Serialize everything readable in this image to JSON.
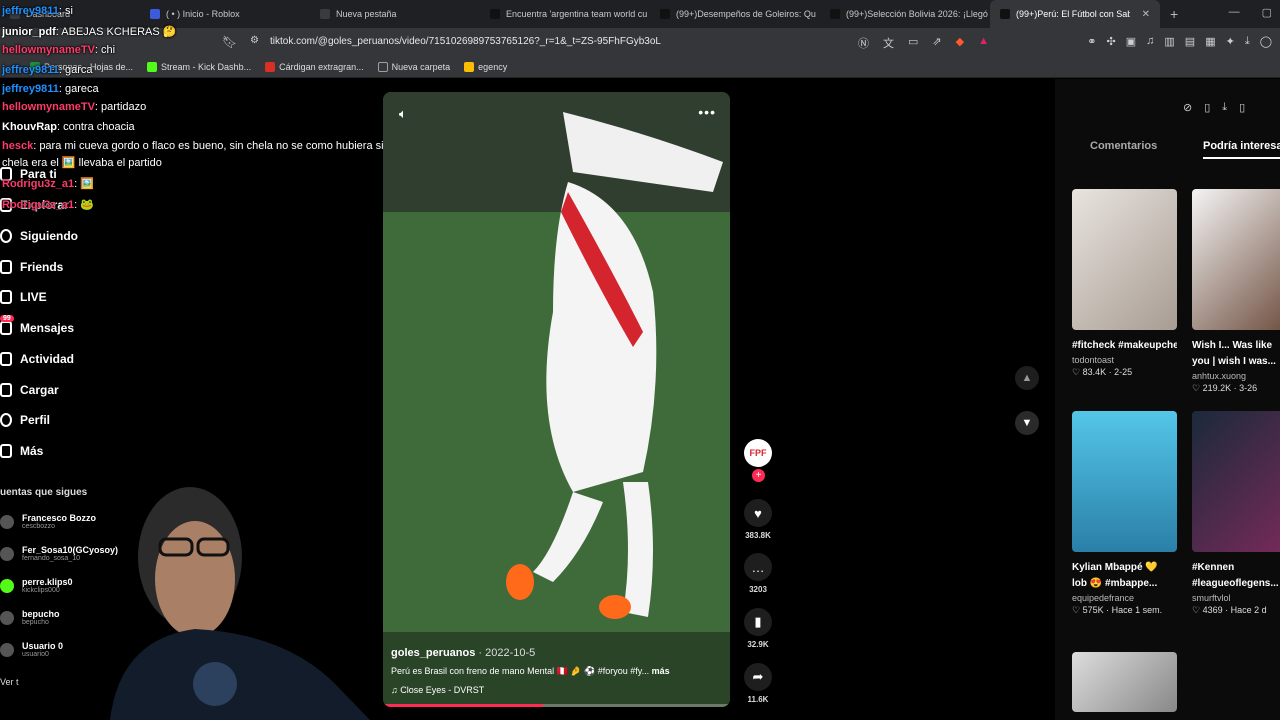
{
  "browser": {
    "tabs": [
      {
        "label": "Dashboard",
        "active": false
      },
      {
        "label": "( • ) Inicio - Roblox",
        "active": false
      },
      {
        "label": "Nueva pestaña",
        "active": false
      },
      {
        "label": "Encuentra 'argentina team world cu",
        "active": false
      },
      {
        "label": "(99+)Desempeños de Goleiros: Qu",
        "active": false
      },
      {
        "label": "(99+)Selección Bolivia 2026: ¡Llegó l",
        "active": false
      },
      {
        "label": "(99+)Perú: El Fútbol con Sabor a",
        "active": true
      }
    ],
    "new_tab_icon": "plus-icon",
    "url": "tiktok.com/@goles_peruanos/video/7151026989753765126?_r=1&_t=ZS-95FhFGyb3oL",
    "bookmarks": [
      {
        "label": "Personas · Hojas de...",
        "color": "#1e8e3e"
      },
      {
        "label": "Stream - Kick Dashb...",
        "color": "#53fc18"
      },
      {
        "label": "Cárdigan extragran...",
        "color": "#d93025"
      },
      {
        "label": "Nueva carpeta",
        "color": "#9aa0a6"
      },
      {
        "label": "egency",
        "color": "#fbbc04"
      }
    ]
  },
  "chat": [
    {
      "user": "jeffrey9811",
      "text": ": si",
      "color": "#1e90ff"
    },
    {
      "user": "junior_pdf",
      "text": ": ABEJAS KCHERAS 🤔",
      "color": "#ffffff"
    },
    {
      "user": "hellowmynameTV",
      "text": ": chi",
      "color": "#ff3b6b"
    },
    {
      "user": "jeffrey9811",
      "text": ": garca",
      "color": "#1e90ff"
    },
    {
      "user": "jeffrey9811",
      "text": ": gareca",
      "color": "#1e90ff"
    },
    {
      "user": "hellowmynameTV",
      "text": ": partidazo",
      "color": "#ff3b6b"
    },
    {
      "user": "KhouvRap",
      "text": ": contra choacia",
      "color": "#ffffff"
    },
    {
      "user": "hesck",
      "text": ": para mi cueva gordo o flaco es bueno, sin chela no se como hubiera sido, con",
      "color": "#ff3b6b"
    },
    {
      "user": "",
      "text": "chela era el 🖼️ llevaba el partido",
      "color": "#ffffff"
    },
    {
      "user": "Rodrigu3z_a1",
      "text": ": 🖼️",
      "color": "#ff3b6b"
    },
    {
      "user": "Rodrigu3z_a1",
      "text": ": 🐸",
      "color": "#ff3b6b"
    }
  ],
  "sidebar": {
    "items": [
      {
        "label": "Para ti",
        "icon": "home-icon"
      },
      {
        "label": "Explorar",
        "icon": "compass-icon"
      },
      {
        "label": "Siguiendo",
        "icon": "following-icon"
      },
      {
        "label": "Friends",
        "icon": "friends-icon"
      },
      {
        "label": "LIVE",
        "icon": "live-icon"
      },
      {
        "label": "Mensajes",
        "icon": "message-icon",
        "badge": "99"
      },
      {
        "label": "Actividad",
        "icon": "activity-icon"
      },
      {
        "label": "Cargar",
        "icon": "upload-icon"
      },
      {
        "label": "Perfil",
        "icon": "profile-icon"
      },
      {
        "label": "Más",
        "icon": "more-icon"
      }
    ],
    "following_title": "uentas que sigues",
    "following": [
      {
        "name": "Francesco Bozzo",
        "handle": "cescbozzo"
      },
      {
        "name": "Fer_Sosa10(GCyosoy)",
        "handle": "fernando_sosa_10"
      },
      {
        "name": "perre.klips0",
        "handle": "kickclips000"
      },
      {
        "name": "bepucho",
        "handle": "bepucho"
      },
      {
        "name": "Usuario 0",
        "handle": "usuario0"
      }
    ],
    "see_all": "Ver t"
  },
  "video": {
    "author": "goles_peruanos",
    "date": " · 2022-10-5",
    "caption": "Perú es Brasil con freno de mano Mental 🇵🇪 🤌 ⚽ #foryou #fy...",
    "more": "más",
    "music": "♫  Close Eyes - DVRST",
    "progress": 0.46,
    "mute_icon": "volume-icon",
    "more_icon": "more-dots-icon"
  },
  "actions": {
    "likes": "383.8K",
    "comments": "3203",
    "saves": "32.9K",
    "shares": "11.6K"
  },
  "right_panel": {
    "tabs": [
      "Comentarios",
      "Podría interesarte"
    ],
    "active_tab": 1,
    "cards": [
      {
        "title": "#fitcheck #makeupcheck",
        "title2": "",
        "author": "todontoast",
        "likes": "83.4K",
        "date": "2-25"
      },
      {
        "title": "Wish I... Was like",
        "title2": "you | wish I was...",
        "author": "anhtux.xuong",
        "likes": "219.2K",
        "date": "3-26"
      },
      {
        "title": "Kylian Mbappé 💛",
        "title2": "lob 😍 #mbappe...",
        "author": "equipedefrance",
        "likes": "575K",
        "date": "Hace 1 sem."
      },
      {
        "title": "#Kennen",
        "title2": "#leagueoflegens...",
        "author": "smurftvlol",
        "likes": "4369",
        "date": "Hace 2 d"
      }
    ]
  },
  "colors": {
    "accent": "#fe2c55",
    "bg": "#000000",
    "chrome": "#35363a"
  }
}
